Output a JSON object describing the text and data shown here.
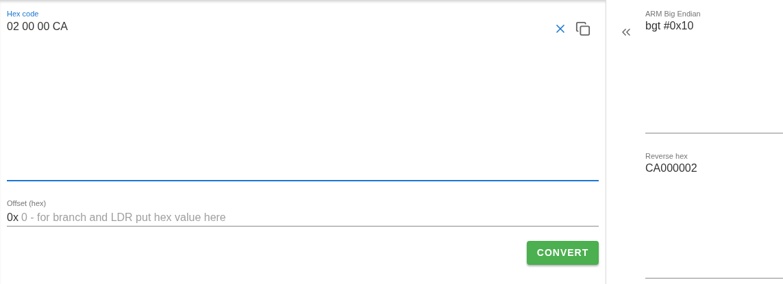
{
  "hex_input": {
    "label": "Hex code",
    "value": "02 00 00 CA",
    "focused": true
  },
  "offset": {
    "label": "Offset (hex)",
    "prefix": "0x",
    "placeholder": "0 - for branch and LDR put hex value here"
  },
  "convert_button": "CONVERT",
  "outputs": [
    {
      "label": "ARM Big Endian",
      "value": "bgt #0x10"
    },
    {
      "label": "Reverse hex",
      "value": "CA000002"
    }
  ]
}
